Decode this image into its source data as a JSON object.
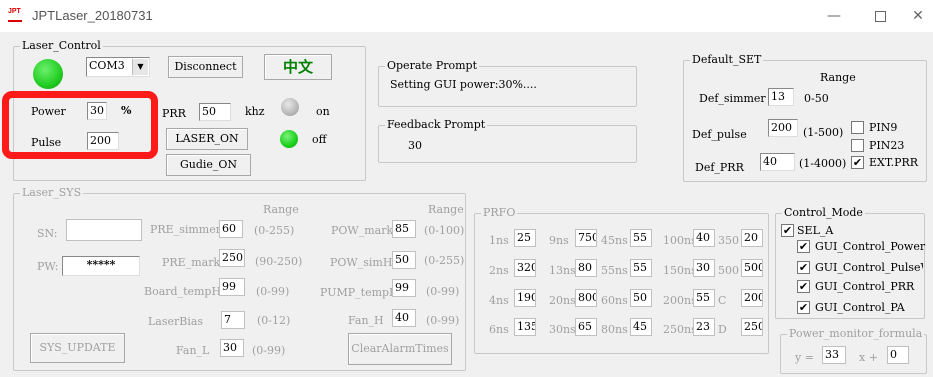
{
  "window": {
    "title": "JPTLaser_20180731",
    "icon_text": "JPT",
    "minimize_icon": "minimize-icon",
    "maximize_icon": "maximize-icon",
    "close_icon": "close-icon"
  },
  "laser_control": {
    "label": "Laser_Control",
    "led_color": "#22cc22",
    "com_port": "COM3",
    "disconnect_label": "Disconnect",
    "lang_label": "中文",
    "lang_color": "#008000",
    "power_label": "Power",
    "power_value": "30",
    "power_unit": "%",
    "prr_label": "PRR",
    "prr_value": "50",
    "prr_unit": "khz",
    "on_label": "on",
    "on_led_color": "#b4b4b4",
    "pulse_label": "Pulse",
    "pulse_value": "200",
    "laser_on_label": "LASER_ON",
    "off_label": "off",
    "off_led_color": "#18d018",
    "guide_on_label": "Gudie_ON"
  },
  "operate_prompt": {
    "label": "Operate Prompt",
    "text": "Setting GUI power:30%...."
  },
  "feedback_prompt": {
    "label": "Feedback Prompt",
    "text": "30"
  },
  "default_set": {
    "label": "Default_SET",
    "range_label": "Range",
    "def_simmer_label": "Def_simmer",
    "def_simmer_value": "13",
    "def_simmer_range": "0-50",
    "def_pulse_label": "Def_pulse",
    "def_pulse_value": "200",
    "def_pulse_range": "(1-500)",
    "def_prr_label": "Def_PRR",
    "def_prr_value": "40",
    "def_prr_range": "(1-4000)",
    "pin9_label": "PIN9",
    "pin23_label": "PIN23",
    "ext_prr_label": "EXT.PRR",
    "pin9_checked": false,
    "pin23_checked": false,
    "ext_prr_checked": true
  },
  "laser_sys": {
    "label": "Laser_SYS",
    "sn_label": "SN:",
    "sn_value": "",
    "pw_label": "PW:",
    "pw_value": "*****",
    "range1_label": "Range",
    "range2_label": "Range",
    "pre_simmer_label": "PRE_simmer",
    "pre_simmer_value": "60",
    "pre_simmer_range": "(0-255)",
    "pre_mark_label": "PRE_mark",
    "pre_mark_value": "250",
    "pre_mark_range": "(90-250)",
    "board_temph_label": "Board_tempH",
    "board_temph_value": "99",
    "board_temph_range": "(0-99)",
    "laserbias_label": "LaserBias",
    "laserbias_value": "7",
    "laserbias_range": "(0-12)",
    "fan_l_label": "Fan_L",
    "fan_l_value": "30",
    "fan_l_range": "(0-99)",
    "pow_mark_label": "POW_mark",
    "pow_mark_value": "85",
    "pow_mark_range": "(0-100)",
    "pow_simh_label": "POW_simH",
    "pow_simh_value": "50",
    "pow_simh_range": "(0-255)",
    "pump_temph_label": "PUMP_tempH",
    "pump_temph_value": "99",
    "pump_temph_range": "(0-99)",
    "fan_h_label": "Fan_H",
    "fan_h_value": "40",
    "fan_h_range": "(0-99)",
    "sys_update_label": "SYS_UPDATE",
    "clear_alarm_label": "ClearAlarmTimes"
  },
  "prfo": {
    "label": "PRFO",
    "rows": [
      {
        "l1": "1ns",
        "v1": "25",
        "l2": "9ns",
        "v2": "750",
        "l3": "45ns",
        "v3": "55",
        "l4": "100ns",
        "v4": "40",
        "l5": "350",
        "v5": "20"
      },
      {
        "l1": "2ns",
        "v1": "320",
        "l2": "13ns",
        "v2": "80",
        "l3": "55ns",
        "v3": "55",
        "l4": "150ns",
        "v4": "30",
        "l5": "500",
        "v5": "500"
      },
      {
        "l1": "4ns",
        "v1": "190",
        "l2": "20ns",
        "v2": "800",
        "l3": "60ns",
        "v3": "50",
        "l4": "200ns",
        "v4": "55",
        "l5": "C",
        "v5": "200"
      },
      {
        "l1": "6ns",
        "v1": "135",
        "l2": "30ns",
        "v2": "65",
        "l3": "80ns",
        "v3": "45",
        "l4": "250ns",
        "v4": "23",
        "l5": "D",
        "v5": "250"
      }
    ]
  },
  "control_mode": {
    "label": "Control_Mode",
    "sel_a_label": "SEL_A",
    "gui_power_label": "GUI_Control_Power",
    "gui_pulsewidth_label": "GUI_Control_PulseWid",
    "gui_prr_label": "GUI_Control_PRR",
    "gui_pa_label": "GUI_Control_PA",
    "sel_a_checked": true,
    "gui_power_checked": true,
    "gui_pulsewidth_checked": true,
    "gui_prr_checked": true,
    "gui_pa_checked": true
  },
  "power_monitor": {
    "label": "Power_monitor_formula",
    "y_label": "y =",
    "a_value": "33",
    "x_label": "x +",
    "b_value": "0"
  },
  "highlight_color": "#ff1a1a"
}
